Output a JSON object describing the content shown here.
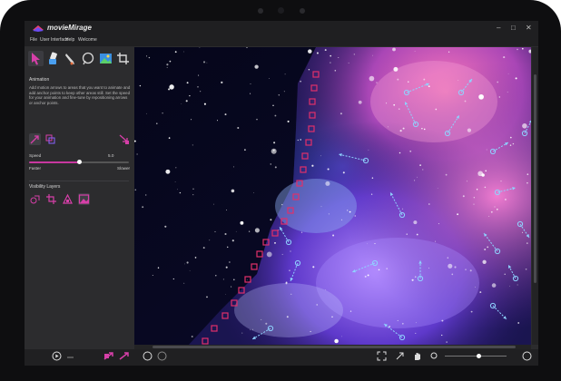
{
  "app": {
    "name": "movieMirage"
  },
  "window_controls": {
    "minimize": "–",
    "maximize": "□",
    "close": "✕"
  },
  "menu": [
    "File",
    "User Interface",
    "Help",
    "Welcome"
  ],
  "tools": [
    {
      "icon": "pink-arrow-tool-icon"
    },
    {
      "icon": "eraser-tool-icon"
    },
    {
      "icon": "pen-tool-icon"
    },
    {
      "icon": "lasso-tool-icon"
    },
    {
      "icon": "image-tool-icon"
    },
    {
      "icon": "crop-tool-icon"
    }
  ],
  "animation": {
    "title": "Animation",
    "description": "Add motion arrows to areas that you want to animate and add anchor points to keep other areas still. Set the speed for your animation and fine-tune by repositioning arrows or anchor points."
  },
  "speed": {
    "label": "Speed",
    "value": "5.0",
    "min_label": "Faster",
    "max_label": "Slower",
    "level": 0.5
  },
  "visibility": {
    "title": "Visibility Layers"
  },
  "colors": {
    "accent": "#c8389f",
    "anchor": "#e0306a",
    "arrow": "#8fd3ff",
    "panel": "#2c2c2e",
    "frame": "#0e0e10"
  }
}
